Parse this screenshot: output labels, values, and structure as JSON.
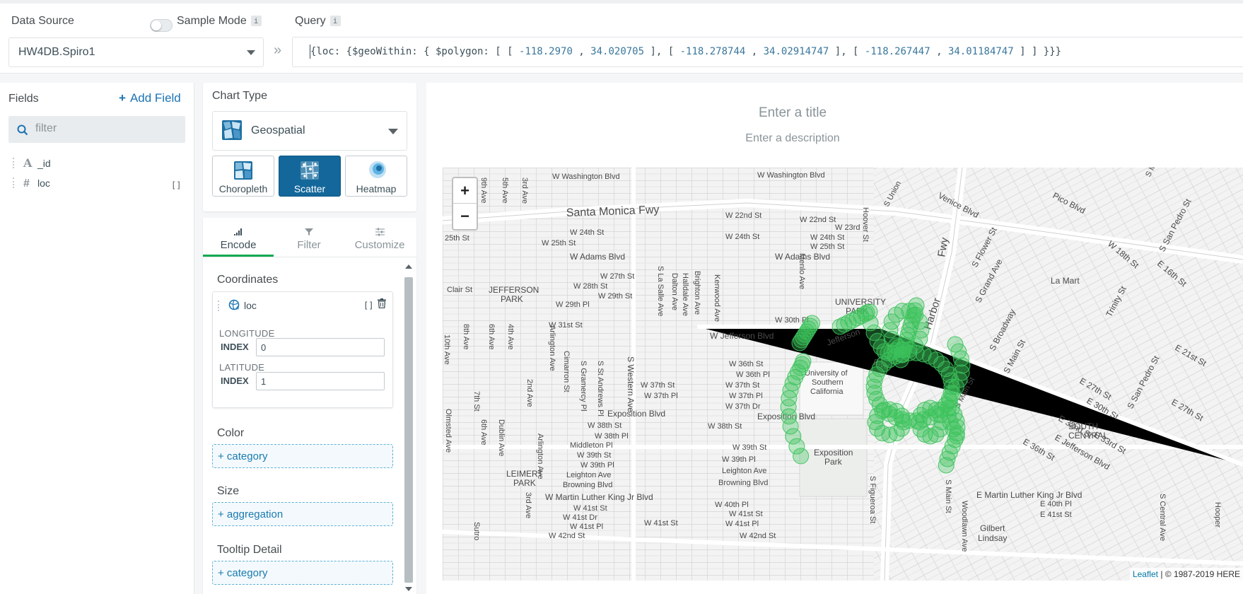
{
  "header": {
    "data_source_label": "Data Source",
    "sample_mode_label": "Sample Mode",
    "info_glyph": "i",
    "query_label": "Query",
    "data_source_value": "HW4DB.Spiro1",
    "chevron": "»",
    "query": {
      "p1": "{loc: {$geoWithin: { $polygon: [ [ ",
      "n1": "-118.2970",
      "p2": " , ",
      "n2": "34.020705",
      "p3": " ], [ ",
      "n3": "-118.278744",
      "p4": " , ",
      "n4": "34.02914747",
      "p5": " ], [ ",
      "n5": "-118.267447",
      "p6": " , ",
      "n6": "34.01184747",
      "p7": " ] ] }}}"
    },
    "sample_mode_on": false
  },
  "fields": {
    "title": "Fields",
    "add_field": "Add Field",
    "add_plus": "+",
    "filter_placeholder": "filter",
    "items": [
      {
        "name": "_id",
        "type_glyph": "A"
      },
      {
        "name": "loc",
        "type_glyph": "#",
        "array_glyph": "[]"
      }
    ]
  },
  "chart_type": {
    "title": "Chart Type",
    "selected": "Geospatial",
    "subtypes": [
      "Choropleth",
      "Scatter",
      "Heatmap"
    ],
    "active_subtype": "Scatter"
  },
  "encode": {
    "tabs": [
      "Encode",
      "Filter",
      "Customize"
    ],
    "active_tab": "Encode",
    "coordinates_title": "Coordinates",
    "coord_field": "loc",
    "coord_array_glyph": "[]",
    "longitude_label": "LONGITUDE",
    "latitude_label": "LATITUDE",
    "index_label": "INDEX",
    "longitude_index": "0",
    "latitude_index": "1",
    "color_title": "Color",
    "color_drop": "+ category",
    "size_title": "Size",
    "size_drop": "+ aggregation",
    "tooltip_title": "Tooltip Detail",
    "tooltip_drop": "+ category"
  },
  "chart": {
    "title_placeholder": "Enter a title",
    "description_placeholder": "Enter a description",
    "zoom_in": "+",
    "zoom_out": "−",
    "attribution_link": "Leaflet",
    "attribution_text": "| © 1987-2019 HERE",
    "marker_color": "#3cc25b"
  },
  "map_labels": {
    "w_washington": "W Washington Blvd",
    "santa_monica": "Santa Monica Fwy",
    "w_22nd": "W 22nd St",
    "w_22nd_b": "W 22nd St",
    "w_23rd": "W 23rd",
    "w_24th": "W 24th St",
    "w_24th_b": "W 24th St",
    "w_24th_c": "W 24th St",
    "w_25th": "W 25th St",
    "w_25th_b": "W 25th St",
    "w_25th_c": "25th St",
    "w_adams": "W Adams Blvd",
    "w_adams_b": "W Adams Blvd",
    "w_27th": "W 27th St",
    "w_28th": "W 28th St",
    "w_29th": "W 29th St",
    "w_29th_pl": "W 29th Pl",
    "w_30th_pl": "W 30th Pl",
    "w_31st": "W 31st St",
    "jefferson_park_1": "JEFFERSON",
    "jefferson_park_2": "PARK",
    "clair": "Clair St",
    "university_park_1": "UNIVERSITY",
    "university_park_2": "PARK",
    "w_jefferson": "W Jefferson Blvd",
    "jefferson": "Jefferson",
    "blvd": "Blvd",
    "harbor": "Harbor",
    "fwy": "Fwy",
    "la_mart": "La Mart",
    "usc_1": "University of",
    "usc_2": "Southern",
    "usc_3": "California",
    "w_36th": "W 36th St",
    "w_36th_pl": "W 36th Pl",
    "w_37th": "W 37th St",
    "w_37th_pl": "W 37th Pl",
    "w_37th_dr": "W 37th Dr",
    "w_37th_b": "W 37th St",
    "w_37th_pl_b": "W 37th Pl",
    "exposition": "Exposition Blvd",
    "exposition_b": "Exposition Blvd",
    "w_38th": "W 38th St",
    "w_38th_b": "W 38th St",
    "w_38th_pl": "W 38th Pl",
    "middleton": "Middleton Pl",
    "w_39th": "W 39th St",
    "w_39th_b": "W 39th St",
    "w_39th_pl": "W 39th Pl",
    "w_39th_pl_b": "W 39th Pl",
    "leighton": "Leighton Ave",
    "leighton_b": "Leighton Ave",
    "browning": "Browning Blvd",
    "browning_b": "Browning Blvd",
    "expo_park_1": "Exposition",
    "expo_park_2": "Park",
    "leimert_1": "LEIMERT",
    "leimert_2": "PARK",
    "mlk": "W Martin Luther King Jr Blvd",
    "e_mlk": "E Martin Luther King Jr Blvd",
    "w_41st": "W 41st St",
    "w_41st_dr": "W 41st Dr",
    "w_41st_pl": "W 41st Pl",
    "w_41st_b": "W 41st St",
    "w_41st_pl_b": "W 41st Pl",
    "w_40th_pl": "W 40th Pl",
    "w_41st_c": "W 41st St",
    "w_42nd": "W 42nd St",
    "w_42nd_b": "W 42nd St",
    "w_41st_pl_c": "W 41st Pl",
    "e_40th_pl": "E 40th Pl",
    "e_41st": "E 41st St",
    "south_central_1": "SOUTH",
    "south_central_2": "CENTRAL",
    "gilbert_1": "Gilbert",
    "gilbert_2": "Lindsay",
    "venice": "Venice Blvd",
    "pico": "Pico Blvd",
    "w_18th": "W 18th St",
    "e_16th": "E 16th St",
    "e_21st": "E 21st St",
    "e_27th": "E 27th St",
    "e_27th_b": "E 27th St",
    "e_30th": "E 30th St",
    "e_32nd": "E 32nd St",
    "e_33rd": "E 33rd St",
    "e_jefferson": "E Jefferson Blvd",
    "e_36th": "E 36th St",
    "grand": "S Grand Ave",
    "broadway": "S Broadway",
    "main": "S Main St",
    "san_pedro": "S San Pedro St",
    "san_pedro_b": "S San Pedro St",
    "flower": "S Flower St",
    "trinity": "Trinity St",
    "hoover": "Hoover St",
    "union": "S Union",
    "figueroa": "S Figueroa St",
    "western": "S Western Ave",
    "arlington": "Arlington Ave",
    "arlington_b": "Arlington Ave",
    "menlo": "Menlo Ave",
    "kenwood": "Kenwood Ave",
    "brighton": "Brighton Ave",
    "halldale": "Halldale Ave",
    "dalton": "Dalton Ave",
    "la_salle": "S La Salle Ave",
    "st_andrews": "S St Andrews Pl",
    "gramercy": "S Gramercy Pl",
    "cimarron": "Cimarron St",
    "olmsted": "Olmsted Ave",
    "dublin": "Dublin Ave",
    "sixth": "6th Ave",
    "sixth_b": "6th Ave",
    "fourth": "4th Ave",
    "second": "2nd Ave",
    "third": "3rd Ave",
    "third_b": "3rd Ave",
    "fifth": "5th Ave",
    "seventh": "7th St",
    "eighth": "8th Ave",
    "tenth": "10th Ave",
    "ninth": "9th Ave",
    "central": "S Central Ave",
    "main_b": "S Main St",
    "woodlawn": "Woodlawn Ave",
    "s_main": "S Main St",
    "s_ma": "S Ma",
    "sutro": "Sutro",
    "hooper": "Hooper"
  }
}
